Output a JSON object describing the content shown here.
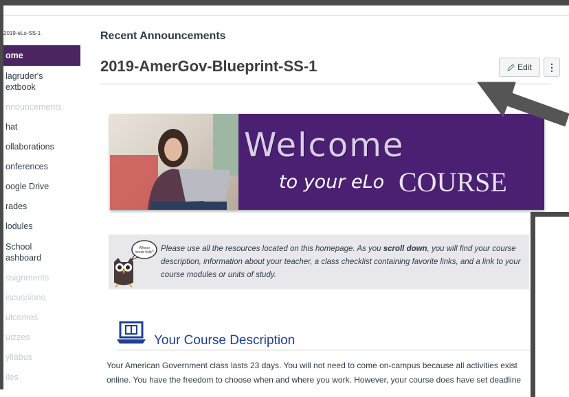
{
  "course": {
    "crumb": "2019-eLo-SS-1"
  },
  "sidebar": {
    "items": [
      {
        "label": "Home",
        "shown": "ome",
        "state": "active"
      },
      {
        "label": "Magruder's Textbook",
        "shown1": "lagruder's",
        "shown2": "extbook",
        "state": "normal"
      },
      {
        "label": "Announcements",
        "shown": "nnouncements",
        "state": "dim"
      },
      {
        "label": "Chat",
        "shown": "hat",
        "state": "normal"
      },
      {
        "label": "Collaborations",
        "shown": "ollaborations",
        "state": "normal"
      },
      {
        "label": "Conferences",
        "shown": "onferences",
        "state": "normal"
      },
      {
        "label": "Google Drive",
        "shown": "oogle Drive",
        "state": "normal"
      },
      {
        "label": "Grades",
        "shown": "rades",
        "state": "normal"
      },
      {
        "label": "Modules",
        "shown": "lodules",
        "state": "normal"
      },
      {
        "label": "School Dashboard",
        "shown1": "School",
        "shown2": "ashboard",
        "state": "normal"
      },
      {
        "label": "Assignments",
        "shown": "ssignments",
        "state": "dim"
      },
      {
        "label": "Discussions",
        "shown": "iscussions",
        "state": "dim"
      },
      {
        "label": "Outcomes",
        "shown": "utcomes",
        "state": "dim"
      },
      {
        "label": "Quizzes",
        "shown": "uizzes",
        "state": "dim"
      },
      {
        "label": "Syllabus",
        "shown": "yllabus",
        "state": "dim"
      },
      {
        "label": "Files",
        "shown": "iles",
        "state": "dim"
      }
    ]
  },
  "main": {
    "recent_announcements": "Recent Announcements",
    "page_title": "2019-AmerGov-Blueprint-SS-1",
    "edit_label": "Edit",
    "more_label": "⋮"
  },
  "banner": {
    "line1": "Welcome",
    "line2": "to your eLo",
    "line3": "COURSE"
  },
  "notice": {
    "part1": "Please use all the resources located on this homepage. As you ",
    "bold": "scroll down",
    "part2": ", you will find your course description, information about your teacher, a class checklist containing favorite links, and a link to your course modules or units of study.",
    "owl_bubble": "Whooo needs help?"
  },
  "description": {
    "heading": "Your Course Description",
    "line1": "Your American Government class lasts 23 days. You will not need to come on-campus because all activities exist",
    "line2": "online. You have the freedom to choose when and where you work. However, your course does have set deadline"
  },
  "colors": {
    "accent": "#4b2561",
    "heading_blue": "#1c3f95",
    "banner_purple": "#4b1f72"
  }
}
